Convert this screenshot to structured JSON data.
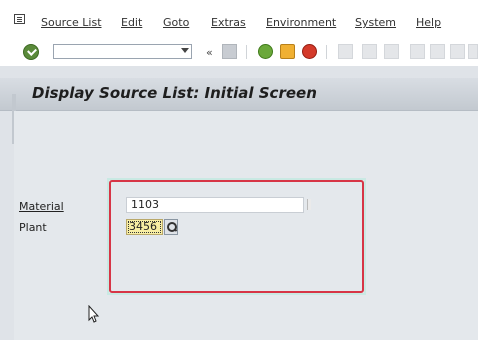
{
  "menubar": {
    "items": [
      "Source List",
      "Edit",
      "Goto",
      "Extras",
      "Environment",
      "System",
      "Help"
    ]
  },
  "toolbar": {
    "command_field_value": "",
    "collapse_glyph": "«",
    "icons": [
      "enter-icon",
      "save-icon",
      "back-icon",
      "exit-icon",
      "cancel-icon",
      "print-icon",
      "find-icon",
      "find-next-icon",
      "first-page-icon",
      "previous-page-icon",
      "next-page-icon",
      "last-page-icon"
    ]
  },
  "title": "Display Source List: Initial Screen",
  "form": {
    "material_label": "Material",
    "material_value": "1103",
    "plant_label": "Plant",
    "plant_value": "3456"
  },
  "colors": {
    "background": "#dfe3e8",
    "focus_field": "#f8eea3",
    "frame_border": "#d73546",
    "highlight_glow": "#c9e9e3"
  }
}
